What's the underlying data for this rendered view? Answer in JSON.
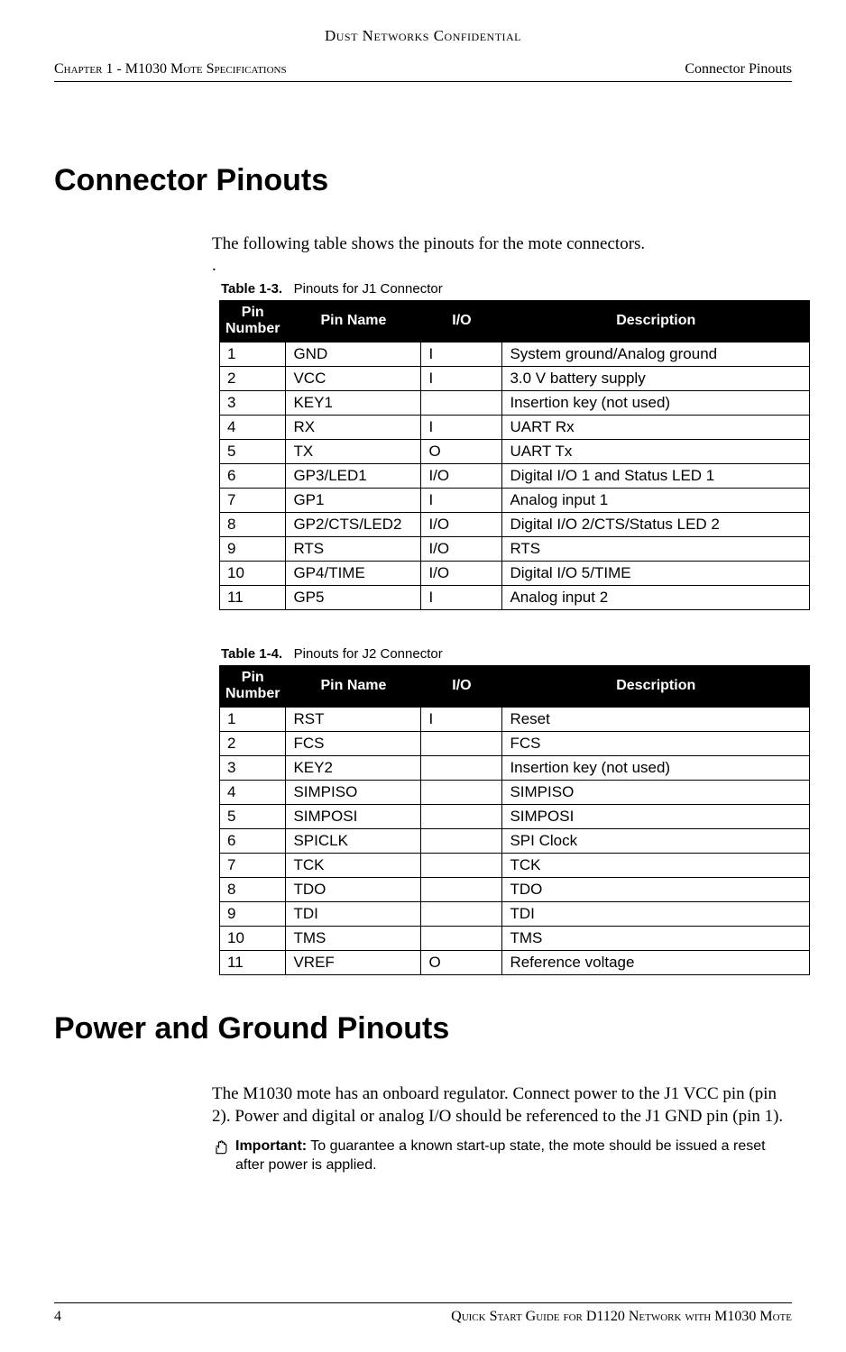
{
  "confidential": "Dust Networks Confidential",
  "header": {
    "left": "Chapter 1 - M1030 Mote Specifications",
    "right": "Connector Pinouts"
  },
  "section1": {
    "title": "Connector Pinouts",
    "intro": "The following table shows the pinouts for the mote connectors.",
    "table1": {
      "label": "Table 1-3.",
      "caption": "Pinouts for J1 Connector",
      "headers": {
        "num": "Pin Number",
        "name": "Pin Name",
        "io": "I/O",
        "desc": "Description"
      },
      "rows": [
        {
          "num": "1",
          "name": "GND",
          "io": "I",
          "desc": "System ground/Analog ground"
        },
        {
          "num": "2",
          "name": "VCC",
          "io": "I",
          "desc": "3.0 V battery supply"
        },
        {
          "num": "3",
          "name": "KEY1",
          "io": "",
          "desc": "Insertion key (not used)"
        },
        {
          "num": "4",
          "name": "RX",
          "io": "I",
          "desc": "UART Rx"
        },
        {
          "num": "5",
          "name": "TX",
          "io": "O",
          "desc": "UART Tx"
        },
        {
          "num": "6",
          "name": "GP3/LED1",
          "io": "I/O",
          "desc": "Digital I/O 1 and Status LED 1"
        },
        {
          "num": "7",
          "name": "GP1",
          "io": "I",
          "desc": "Analog input 1"
        },
        {
          "num": "8",
          "name": "GP2/CTS/LED2",
          "io": "I/O",
          "desc": "Digital I/O 2/CTS/Status LED 2"
        },
        {
          "num": "9",
          "name": "RTS",
          "io": "I/O",
          "desc": "RTS"
        },
        {
          "num": "10",
          "name": "GP4/TIME",
          "io": "I/O",
          "desc": "Digital I/O 5/TIME"
        },
        {
          "num": "11",
          "name": "GP5",
          "io": "I",
          "desc": "Analog input 2"
        }
      ]
    },
    "table2": {
      "label": "Table 1-4.",
      "caption": "Pinouts for J2 Connector",
      "headers": {
        "num": "Pin Number",
        "name": "Pin Name",
        "io": "I/O",
        "desc": "Description"
      },
      "rows": [
        {
          "num": "1",
          "name": "RST",
          "io": "I",
          "desc": "Reset"
        },
        {
          "num": "2",
          "name": "FCS",
          "io": "",
          "desc": "FCS"
        },
        {
          "num": "3",
          "name": "KEY2",
          "io": "",
          "desc": "Insertion key (not used)"
        },
        {
          "num": "4",
          "name": "SIMPISO",
          "io": "",
          "desc": "SIMPISO"
        },
        {
          "num": "5",
          "name": "SIMPOSI",
          "io": "",
          "desc": "SIMPOSI"
        },
        {
          "num": "6",
          "name": "SPICLK",
          "io": "",
          "desc": "SPI Clock"
        },
        {
          "num": "7",
          "name": "TCK",
          "io": "",
          "desc": "TCK"
        },
        {
          "num": "8",
          "name": "TDO",
          "io": "",
          "desc": "TDO"
        },
        {
          "num": "9",
          "name": "TDI",
          "io": "",
          "desc": "TDI"
        },
        {
          "num": "10",
          "name": "TMS",
          "io": "",
          "desc": "TMS"
        },
        {
          "num": "11",
          "name": "VREF",
          "io": "O",
          "desc": "Reference voltage"
        }
      ]
    }
  },
  "section2": {
    "title": "Power and Ground Pinouts",
    "body": "The M1030 mote has an onboard regulator. Connect power to the J1 VCC pin (pin 2). Power and digital or analog I/O should be referenced to the J1  GND pin (pin 1).",
    "important_label": "Important:",
    "important_text": " To guarantee a known start-up state, the mote should be issued a reset after power is applied."
  },
  "footer": {
    "left": "4",
    "right": "Quick Start Guide for D1120 Network with M1030 Mote"
  }
}
